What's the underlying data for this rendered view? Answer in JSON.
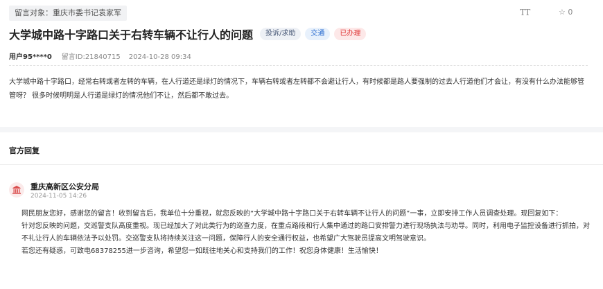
{
  "target": {
    "label": "留言对象：重庆市委书记袁家军"
  },
  "tools": {
    "font_size_label": "TT",
    "fav_count": "0"
  },
  "post": {
    "title": "大学城中路十字路口关于右转车辆不让行人的问题",
    "tags": {
      "type": "投诉/求助",
      "category": "交通",
      "status": "已办理"
    },
    "user": "用户95****0",
    "id_label": "留言ID:21840715",
    "datetime": "2024-10-28 09:34",
    "content": "大学城中路十字路口，经常右转或者左转的车辆，在人行道还是绿灯的情况下，车辆右转或者左转都不会避让行人，有时候都是路人要强制的过去人行道他们才会让，有没有什么办法能够管管呀？ 很多时候明明是人行道是绿灯的情况他们不让，然后都不敢过去。"
  },
  "reply": {
    "header": "官方回复",
    "org": "重庆高新区公安分局",
    "time": "2024-11-05 14:26",
    "paragraphs": [
      "网民朋友您好，感谢您的留言！收到留言后，我单位十分重视，就您反映的“大学城中路十字路口关于右转车辆不让行人的问题”一事，立即安排工作人员调查处理。现回复如下：",
      "针对您反映的问题，交巡警支队高度重视。现已经加大了对此类行为的巡查力度，在重点路段和行人集中通过的路口安排警力进行现场执法与劝导。同时，利用电子监控设备进行抓拍，对不礼让行人的车辆依法予以处罚。交巡警支队将持续关注这一问题，保障行人的安全通行权益，也希望广大驾驶员提高文明驾驶意识。",
      "若您还有疑惑，可致电68378255进一步咨询，希望您一如既往地关心和支持我们的工作！祝您身体健康！生活愉快！"
    ]
  },
  "colors": {
    "status_red": "#e03838",
    "category_blue": "#2e6fd0",
    "icon_red": "#d94a4a"
  }
}
